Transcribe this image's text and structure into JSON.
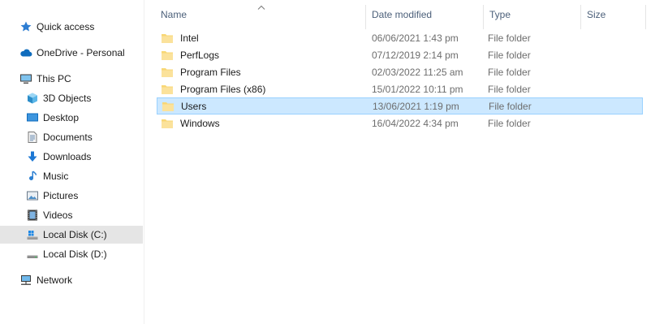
{
  "nav": {
    "quick_access": "Quick access",
    "onedrive": "OneDrive - Personal",
    "this_pc": "This PC",
    "objects_3d": "3D Objects",
    "desktop": "Desktop",
    "documents": "Documents",
    "downloads": "Downloads",
    "music": "Music",
    "pictures": "Pictures",
    "videos": "Videos",
    "local_disk_c": "Local Disk (C:)",
    "local_disk_d": "Local Disk (D:)",
    "network": "Network",
    "selected": "Local Disk (C:)"
  },
  "columns": {
    "name": "Name",
    "date_modified": "Date modified",
    "type": "Type",
    "size": "Size"
  },
  "files": [
    {
      "name": "Intel",
      "date": "06/06/2021 1:43 pm",
      "type": "File folder"
    },
    {
      "name": "PerfLogs",
      "date": "07/12/2019 2:14 pm",
      "type": "File folder"
    },
    {
      "name": "Program Files",
      "date": "02/03/2022 11:25 am",
      "type": "File folder"
    },
    {
      "name": "Program Files (x86)",
      "date": "15/01/2022 10:11 pm",
      "type": "File folder"
    },
    {
      "name": "Users",
      "date": "13/06/2021 1:19 pm",
      "type": "File folder",
      "selected": true
    },
    {
      "name": "Windows",
      "date": "16/04/2022 4:34 pm",
      "type": "File folder"
    }
  ],
  "colors": {
    "selection_fill": "#cce8ff",
    "selection_border": "#99d1ff",
    "nav_selected": "#e5e5e5",
    "header_text": "#4c607a",
    "folder": "#f8d775"
  }
}
